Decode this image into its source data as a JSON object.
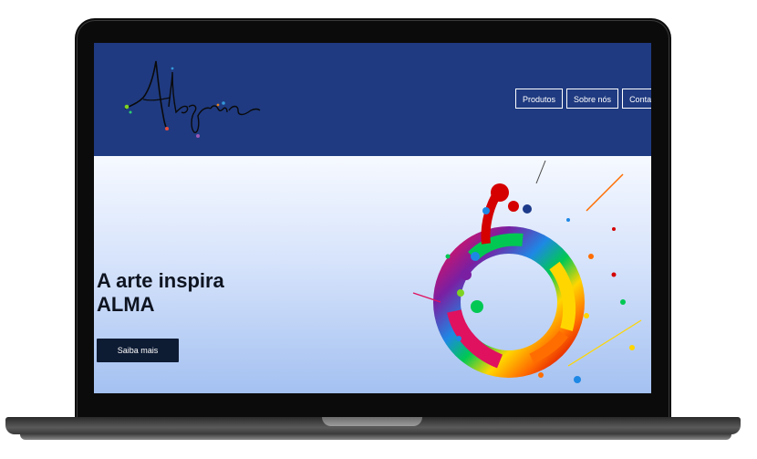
{
  "site": {
    "logo_text": "Alegria",
    "nav": {
      "items": [
        "Produtos",
        "Sobre nós",
        "Contat"
      ]
    },
    "hero": {
      "title_line1": "A arte inspira",
      "title_line2": "ALMA",
      "cta_label": "Saiba mais"
    }
  },
  "colors": {
    "header_bg": "#1f3a80",
    "cta_bg": "#0d1b33",
    "hero_gradient_top": "#f6f9ff",
    "hero_gradient_bottom": "#a4c1f1"
  }
}
